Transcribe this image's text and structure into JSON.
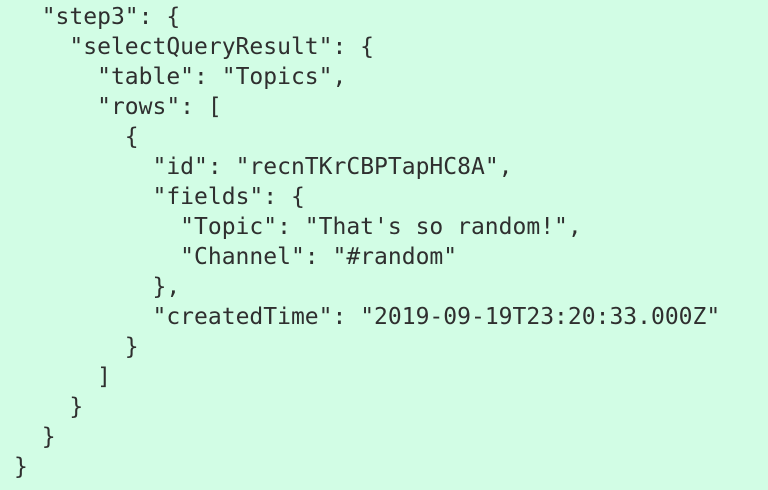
{
  "editor": {
    "background": "#d2fde5",
    "text_color": "#2f2f2f",
    "lines": [
      {
        "indent": 1,
        "text": "\"step3\": {"
      },
      {
        "indent": 2,
        "text": "\"selectQueryResult\": {"
      },
      {
        "indent": 3,
        "text": "\"table\": \"Topics\","
      },
      {
        "indent": 3,
        "text": "\"rows\": ["
      },
      {
        "indent": 4,
        "text": "{"
      },
      {
        "indent": 5,
        "text": "\"id\": \"recnTKrCBPTapHC8A\","
      },
      {
        "indent": 5,
        "text": "\"fields\": {"
      },
      {
        "indent": 6,
        "text": "\"Topic\": \"That's so random!\","
      },
      {
        "indent": 6,
        "text": "\"Channel\": \"#random\""
      },
      {
        "indent": 5,
        "text": "},"
      },
      {
        "indent": 5,
        "text": "\"createdTime\": \"2019-09-19T23:20:33.000Z\""
      },
      {
        "indent": 4,
        "text": "}"
      },
      {
        "indent": 3,
        "text": "]"
      },
      {
        "indent": 2,
        "text": "}"
      },
      {
        "indent": 1,
        "text": "}"
      },
      {
        "indent": 0,
        "text": "}"
      }
    ]
  }
}
